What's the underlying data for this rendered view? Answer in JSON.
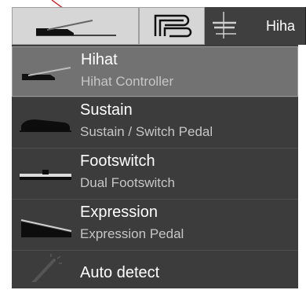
{
  "tabs": [
    {
      "icon": "hihat-pedal-icon",
      "label": ""
    },
    {
      "icon": "brand-logo-icon",
      "label": ""
    },
    {
      "icon": "cymbal-icon",
      "label": "Hiha"
    }
  ],
  "menu": {
    "items": [
      {
        "title": "Hihat",
        "subtitle": "Hihat Controller",
        "icon": "hihat-pedal-icon",
        "selected": true
      },
      {
        "title": "Sustain",
        "subtitle": "Sustain / Switch Pedal",
        "icon": "sustain-pedal-icon",
        "selected": false
      },
      {
        "title": "Footswitch",
        "subtitle": "Dual Footswitch",
        "icon": "footswitch-icon",
        "selected": false
      },
      {
        "title": "Expression",
        "subtitle": "Expression Pedal",
        "icon": "expression-pedal-icon",
        "selected": false
      },
      {
        "title": "Auto detect",
        "subtitle": "",
        "icon": "magic-wand-icon",
        "selected": false
      }
    ]
  },
  "colors": {
    "annotation": "#e00000",
    "selected": "#727272",
    "menu_bg": "#3c3c3c"
  }
}
